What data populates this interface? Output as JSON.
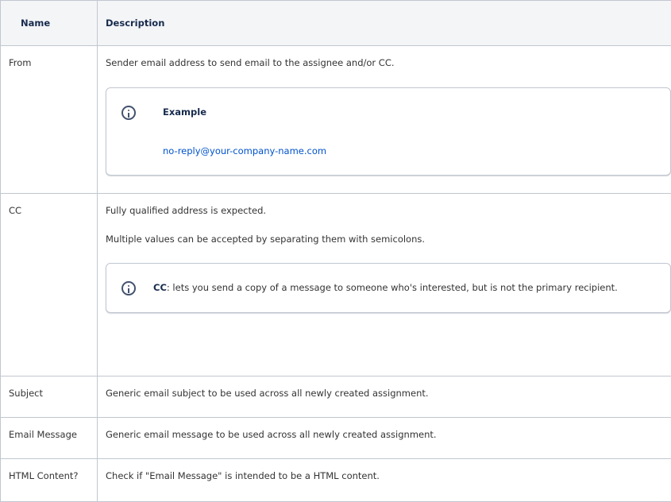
{
  "table": {
    "headers": {
      "name": "Name",
      "description": "Description"
    },
    "rows": {
      "from": {
        "name": "From",
        "description": "Sender email address to send email to the assignee and/or CC.",
        "panel": {
          "icon": "info-icon",
          "title": "Example",
          "link_text": "no-reply@your-company-name.com"
        }
      },
      "cc": {
        "name": "CC",
        "description_1": "Fully qualified address is expected.",
        "description_2": "Multiple values can be accepted by separating them with semicolons.",
        "panel": {
          "icon": "info-icon",
          "term": "CC",
          "text": ": lets you send a copy of a message to someone who's interested, but is not the primary recipient."
        }
      },
      "subject": {
        "name": "Subject",
        "description": "Generic email subject to be used across all newly created assignment."
      },
      "email_message": {
        "name": "Email Message",
        "description": "Generic email message to be used across all newly created assignment."
      },
      "html_content": {
        "name": "HTML Content?",
        "description": "Check if \"Email Message\" is intended to be a HTML content."
      }
    }
  },
  "colors": {
    "border": "#c1c7d0",
    "header_bg": "#f4f5f7",
    "link": "#0052cc",
    "icon": "#42526e"
  }
}
